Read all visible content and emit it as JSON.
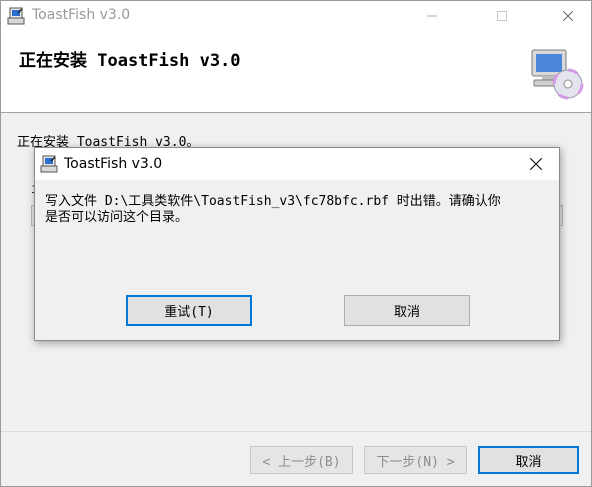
{
  "window": {
    "title": "ToastFish v3.0",
    "header_title": "正在安装 ToastFish v3.0",
    "status_text": "正在安装 ToastFish v3.0。",
    "substatus_label": "i",
    "progress": 0.0
  },
  "buttons": {
    "back": "< 上一步(B)",
    "next": "下一步(N) >",
    "cancel": "取消"
  },
  "dialog": {
    "title": "ToastFish v3.0",
    "message": "写入文件 D:\\工具类软件\\ToastFish_v3\\fc78bfc.rbf 时出错。请确认你\n是否可以访问这个目录。",
    "retry": "重试(T)",
    "cancel": "取消"
  },
  "colors": {
    "accent": "#0078d7",
    "progress_fill": "#06b025"
  }
}
